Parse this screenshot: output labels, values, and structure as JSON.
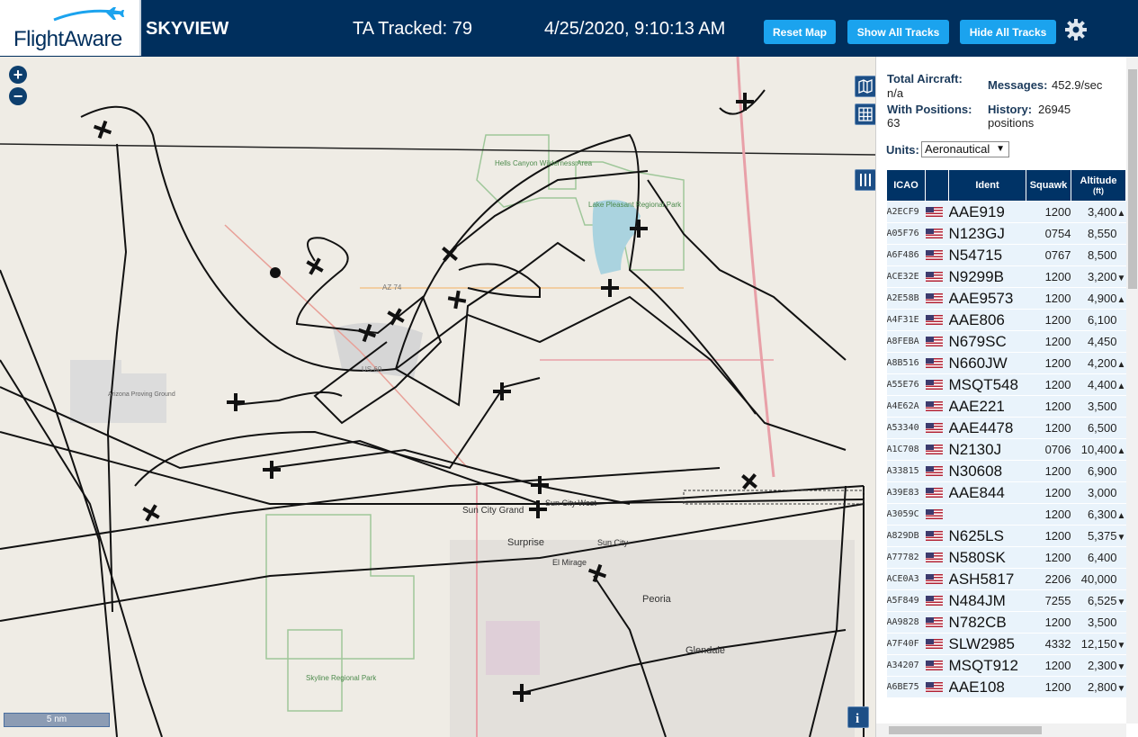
{
  "header": {
    "logo": "FlightAware",
    "app_title": "SKYVIEW",
    "tracked": "TA Tracked: 79",
    "datetime": "4/25/2020, 9:10:13 AM",
    "buttons": {
      "reset": "Reset Map",
      "show": "Show All Tracks",
      "hide": "Hide All Tracks"
    },
    "settings_icon": "gear-icon"
  },
  "map": {
    "zoom_in": "+",
    "zoom_out": "−",
    "scale_label": "5 nm",
    "labels": {
      "sun_city_grand": "Sun City Grand",
      "surprise": "Surprise",
      "sun_city": "Sun City",
      "el_mirage": "El Mirage",
      "peoria": "Peoria",
      "glendale": "Glendale",
      "sun_city_west": "Sun City West",
      "lake_pleasant": "Lake Pleasant Regional Park",
      "hells_canyon": "Hells Canyon Wilderness Area",
      "skyline": "Skyline Regional Park",
      "proving_ground": "Arizona Proving Ground",
      "az74": "AZ 74",
      "us60": "US 60"
    }
  },
  "sidebar": {
    "total_label": "Total Aircraft:",
    "total_value": "n/a",
    "positions_label": "With Positions:",
    "positions_value": "63",
    "messages_label": "Messages:",
    "messages_value": "452.9/sec",
    "history_label": "History:",
    "history_value": "26945",
    "history_unit": "positions",
    "units_label": "Units:",
    "units_value": "Aeronautical",
    "columns": {
      "icao": "ICAO",
      "ident": "Ident",
      "squawk": "Squawk",
      "altitude": "Altitude",
      "altitude_unit": "(ft)"
    },
    "rows": [
      {
        "icao": "A2ECF9",
        "ident": "AAE919",
        "squawk": "1200",
        "alt": "3,400",
        "trend": "▲"
      },
      {
        "icao": "A05F76",
        "ident": "N123GJ",
        "squawk": "0754",
        "alt": "8,550",
        "trend": ""
      },
      {
        "icao": "A6F486",
        "ident": "N54715",
        "squawk": "0767",
        "alt": "8,500",
        "trend": ""
      },
      {
        "icao": "ACE32E",
        "ident": "N9299B",
        "squawk": "1200",
        "alt": "3,200",
        "trend": "▼"
      },
      {
        "icao": "A2E58B",
        "ident": "AAE9573",
        "squawk": "1200",
        "alt": "4,900",
        "trend": "▲"
      },
      {
        "icao": "A4F31E",
        "ident": "AAE806",
        "squawk": "1200",
        "alt": "6,100",
        "trend": ""
      },
      {
        "icao": "A8FEBA",
        "ident": "N679SC",
        "squawk": "1200",
        "alt": "4,450",
        "trend": ""
      },
      {
        "icao": "A8B516",
        "ident": "N660JW",
        "squawk": "1200",
        "alt": "4,200",
        "trend": "▲"
      },
      {
        "icao": "A55E76",
        "ident": "MSQT548",
        "squawk": "1200",
        "alt": "4,400",
        "trend": "▲"
      },
      {
        "icao": "A4E62A",
        "ident": "AAE221",
        "squawk": "1200",
        "alt": "3,500",
        "trend": ""
      },
      {
        "icao": "A53340",
        "ident": "AAE4478",
        "squawk": "1200",
        "alt": "6,500",
        "trend": ""
      },
      {
        "icao": "A1C708",
        "ident": "N2130J",
        "squawk": "0706",
        "alt": "10,400",
        "trend": "▲"
      },
      {
        "icao": "A33815",
        "ident": "N30608",
        "squawk": "1200",
        "alt": "6,900",
        "trend": ""
      },
      {
        "icao": "A39E83",
        "ident": "AAE844",
        "squawk": "1200",
        "alt": "3,000",
        "trend": ""
      },
      {
        "icao": "A3059C",
        "ident": "",
        "squawk": "1200",
        "alt": "6,300",
        "trend": "▲"
      },
      {
        "icao": "A829DB",
        "ident": "N625LS",
        "squawk": "1200",
        "alt": "5,375",
        "trend": "▼"
      },
      {
        "icao": "A77782",
        "ident": "N580SK",
        "squawk": "1200",
        "alt": "6,400",
        "trend": ""
      },
      {
        "icao": "ACE0A3",
        "ident": "ASH5817",
        "squawk": "2206",
        "alt": "40,000",
        "trend": ""
      },
      {
        "icao": "A5F849",
        "ident": "N484JM",
        "squawk": "7255",
        "alt": "6,525",
        "trend": "▼"
      },
      {
        "icao": "AA9828",
        "ident": "N782CB",
        "squawk": "1200",
        "alt": "3,500",
        "trend": ""
      },
      {
        "icao": "A7F40F",
        "ident": "SLW2985",
        "squawk": "4332",
        "alt": "12,150",
        "trend": "▼"
      },
      {
        "icao": "A34207",
        "ident": "MSQT912",
        "squawk": "1200",
        "alt": "2,300",
        "trend": "▼"
      },
      {
        "icao": "A6BE75",
        "ident": "AAE108",
        "squawk": "1200",
        "alt": "2,800",
        "trend": "▼"
      }
    ]
  }
}
